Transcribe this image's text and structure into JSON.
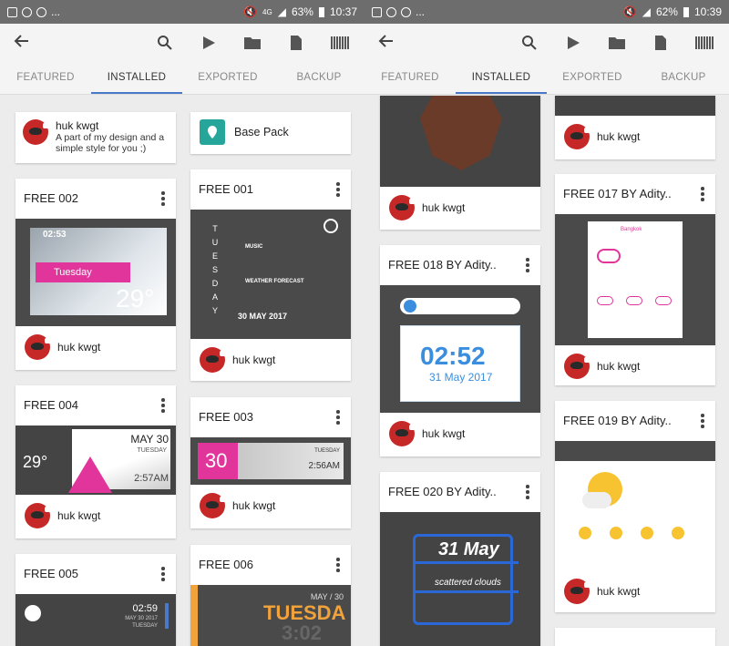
{
  "status_left": {
    "dots": "..."
  },
  "status1": {
    "battery": "63%",
    "time": "10:37",
    "net": "4G"
  },
  "status2": {
    "battery": "62%",
    "time": "10:39"
  },
  "tabs": [
    "FEATURED",
    "INSTALLED",
    "EXPORTED",
    "BACKUP"
  ],
  "author": "huk kwgt",
  "header_card": {
    "name": "huk kwgt",
    "desc": "A part of my design and a simple style for you ;)"
  },
  "base_pack": "Base Pack",
  "cards_s1": {
    "free002": "FREE 002",
    "free001": "FREE 001",
    "free004": "FREE 004",
    "free003": "FREE 003",
    "free005": "FREE 005",
    "free006": "FREE 006"
  },
  "cards_s2": {
    "free018": "FREE 018 BY Adity..",
    "free017": "FREE 017 BY Adity..",
    "free019": "FREE 019 BY Adity..",
    "free020": "FREE 020 BY Adity.."
  },
  "widget_text": {
    "w002_time": "02:53",
    "w002_day": "Tuesday",
    "w002_temp": "29°",
    "w001_letters": [
      "T",
      "U",
      "E",
      "S",
      "D",
      "A",
      "Y"
    ],
    "w001_date": "30 MAY 2017",
    "w001_music": "MUSIC",
    "w001_weather": "WEATHER FORECAST",
    "w004_temp": "29°",
    "w004_date": "MAY 30",
    "w004_day": "TUESDAY",
    "w004_time": "2:57AM",
    "w003_day": "30",
    "w003_label": "TUESDAY",
    "w003_time": "2:56AM",
    "w005_time": "02:59",
    "w005_date": "MAY 30 2017",
    "w005_day": "TUESDAY",
    "w006_date": "MAY / 30",
    "w006_day": "TUESDA",
    "w006_time": "3:02",
    "w018_time": "02:52",
    "w018_date": "31 May 2017",
    "w017_city": "Bangkok",
    "w020_date": "31 May",
    "w020_desc": "scattered clouds"
  },
  "colors": {
    "pink": "#e2359b",
    "accent": "#4a79c9",
    "dark": "#4a4a4a",
    "orange": "#f2a23a"
  }
}
